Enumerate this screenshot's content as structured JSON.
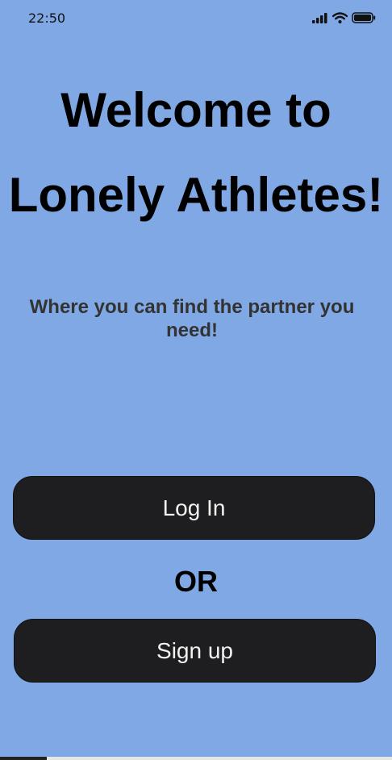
{
  "status_bar": {
    "time": "22:50",
    "icons": [
      "signal-icon",
      "wifi-icon",
      "battery-icon"
    ]
  },
  "welcome": {
    "title_line1": "Welcome to",
    "title_line2": "Lonely Athletes!",
    "subtitle": "Where you can find the partner you need!"
  },
  "actions": {
    "login_label": "Log In",
    "or_label": "OR",
    "signup_label": "Sign up"
  },
  "colors": {
    "background": "#80a8e4",
    "button": "#1e1e20",
    "button_text": "#f2f2f2",
    "subtitle_text": "#333333"
  }
}
